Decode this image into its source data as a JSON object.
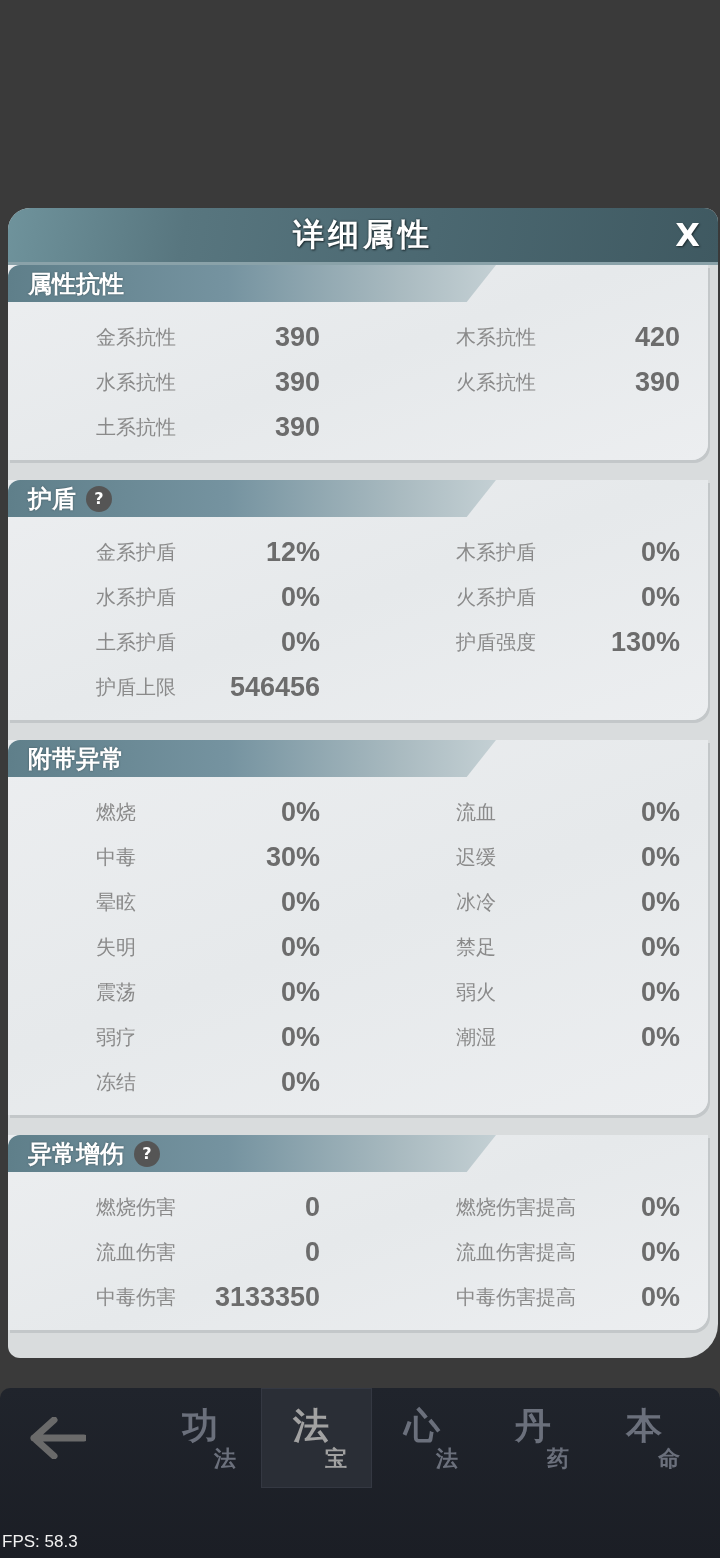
{
  "dialog": {
    "title": "详细属性",
    "close": "X"
  },
  "sections": [
    {
      "title": "属性抗性",
      "stats": [
        {
          "label": "金系抗性",
          "value": "390"
        },
        {
          "label": "木系抗性",
          "value": "420"
        },
        {
          "label": "水系抗性",
          "value": "390"
        },
        {
          "label": "火系抗性",
          "value": "390"
        },
        {
          "label": "土系抗性",
          "value": "390"
        }
      ]
    },
    {
      "title": "护盾",
      "help": "?",
      "stats": [
        {
          "label": "金系护盾",
          "value": "12%"
        },
        {
          "label": "木系护盾",
          "value": "0%"
        },
        {
          "label": "水系护盾",
          "value": "0%"
        },
        {
          "label": "火系护盾",
          "value": "0%"
        },
        {
          "label": "土系护盾",
          "value": "0%"
        },
        {
          "label": "护盾强度",
          "value": "130%"
        },
        {
          "label": "护盾上限",
          "value": "546456"
        }
      ]
    },
    {
      "title": "附带异常",
      "stats": [
        {
          "label": "燃烧",
          "value": "0%"
        },
        {
          "label": "流血",
          "value": "0%"
        },
        {
          "label": "中毒",
          "value": "30%"
        },
        {
          "label": "迟缓",
          "value": "0%"
        },
        {
          "label": "晕眩",
          "value": "0%"
        },
        {
          "label": "冰冷",
          "value": "0%"
        },
        {
          "label": "失明",
          "value": "0%"
        },
        {
          "label": "禁足",
          "value": "0%"
        },
        {
          "label": "震荡",
          "value": "0%"
        },
        {
          "label": "弱火",
          "value": "0%"
        },
        {
          "label": "弱疗",
          "value": "0%"
        },
        {
          "label": "潮湿",
          "value": "0%"
        },
        {
          "label": "冻结",
          "value": "0%"
        }
      ]
    },
    {
      "title": "异常增伤",
      "help": "?",
      "stats": [
        {
          "label": "燃烧伤害",
          "value": "0"
        },
        {
          "label": "燃烧伤害提高",
          "value": "0%"
        },
        {
          "label": "流血伤害",
          "value": "0"
        },
        {
          "label": "流血伤害提高",
          "value": "0%"
        },
        {
          "label": "中毒伤害",
          "value": "3133350"
        },
        {
          "label": "中毒伤害提高",
          "value": "0%"
        }
      ]
    }
  ],
  "nav": {
    "tabs": [
      {
        "main": "功",
        "sub": "法",
        "selected": false
      },
      {
        "main": "法",
        "sub": "宝",
        "selected": true
      },
      {
        "main": "心",
        "sub": "法",
        "selected": false
      },
      {
        "main": "丹",
        "sub": "药",
        "selected": false
      },
      {
        "main": "本",
        "sub": "命",
        "selected": false
      }
    ]
  },
  "fps": "FPS: 58.3"
}
